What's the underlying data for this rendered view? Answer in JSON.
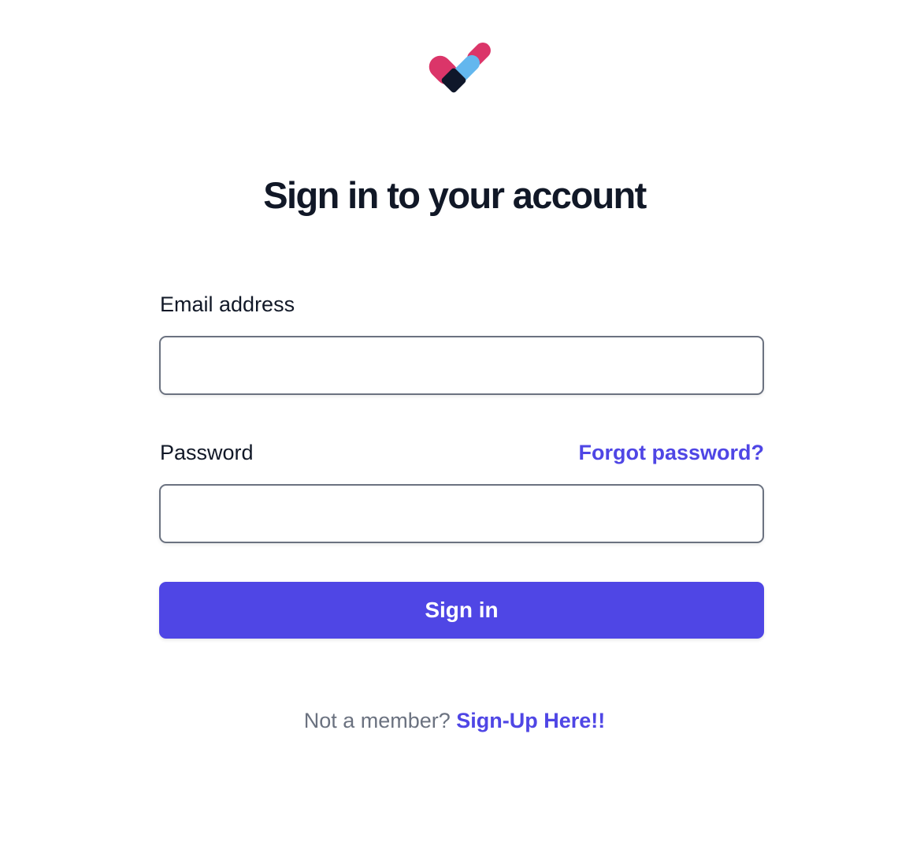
{
  "brand": {
    "logo_icon": "heart-pill-logo-icon",
    "colors": {
      "pink": "#db3569",
      "navy": "#0f172a",
      "sky": "#63b7ee"
    }
  },
  "page": {
    "title": "Sign in to your account"
  },
  "form": {
    "email": {
      "label": "Email address",
      "value": "",
      "placeholder": ""
    },
    "password": {
      "label": "Password",
      "value": "",
      "placeholder": ""
    },
    "forgot_password_label": "Forgot password?",
    "submit_label": "Sign in"
  },
  "footer": {
    "prompt": "Not a member?",
    "signup_label": "Sign-Up Here!!"
  },
  "theme": {
    "accent": "#4f46e5",
    "text": "#111827",
    "muted": "#6b7280",
    "input_border": "#6b7280"
  }
}
